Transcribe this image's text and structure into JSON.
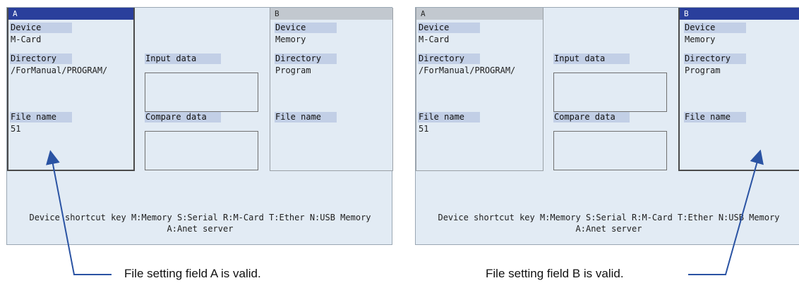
{
  "screens": [
    {
      "panel_left": {
        "title": "A",
        "device_label": "Device",
        "device_value": "M-Card",
        "directory_label": "Directory",
        "directory_value": "/ForManual/PROGRAM/",
        "filename_label": "File name",
        "filename_value": "51"
      },
      "middle": {
        "input_label": "Input data",
        "compare_label": "Compare data"
      },
      "panel_right": {
        "title": "B",
        "device_label": "Device",
        "device_value": "Memory",
        "directory_label": "Directory",
        "directory_value": "Program",
        "filename_label": "File name",
        "filename_value": ""
      },
      "shortcut_line1": "Device shortcut key M:Memory S:Serial R:M-Card T:Ether N:USB Memory",
      "shortcut_line2": "A:Anet server",
      "active_panel": "A"
    },
    {
      "panel_left": {
        "title": "A",
        "device_label": "Device",
        "device_value": "M-Card",
        "directory_label": "Directory",
        "directory_value": "/ForManual/PROGRAM/",
        "filename_label": "File name",
        "filename_value": "51"
      },
      "middle": {
        "input_label": "Input data",
        "compare_label": "Compare data"
      },
      "panel_right": {
        "title": "B",
        "device_label": "Device",
        "device_value": "Memory",
        "directory_label": "Directory",
        "directory_value": "Program",
        "filename_label": "File name",
        "filename_value": ""
      },
      "shortcut_line1": "Device shortcut key M:Memory S:Serial R:M-Card T:Ether N:USB Memory",
      "shortcut_line2": "A:Anet server",
      "active_panel": "B"
    }
  ],
  "captions": {
    "left": "File setting field A is valid.",
    "right": "File setting field B is valid."
  },
  "colors": {
    "active_title_bg": "#2a3f9c",
    "label_bg": "#c2cfe6",
    "screen_bg": "#e2ebf4",
    "arrow": "#2a53a3"
  }
}
